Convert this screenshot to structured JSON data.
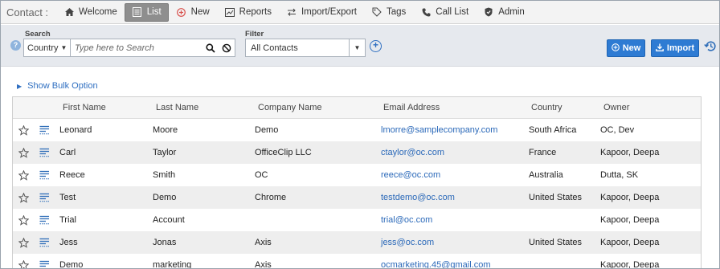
{
  "nav": {
    "module_title": "Contact :",
    "items": [
      {
        "label": "Welcome",
        "icon": "home-icon",
        "active": false
      },
      {
        "label": "List",
        "icon": "list-icon",
        "active": true
      },
      {
        "label": "New",
        "icon": "plus-circle-icon",
        "active": false
      },
      {
        "label": "Reports",
        "icon": "chart-icon",
        "active": false
      },
      {
        "label": "Import/Export",
        "icon": "transfer-icon",
        "active": false
      },
      {
        "label": "Tags",
        "icon": "tag-icon",
        "active": false
      },
      {
        "label": "Call List",
        "icon": "phone-icon",
        "active": false
      },
      {
        "label": "Admin",
        "icon": "shield-icon",
        "active": false
      }
    ]
  },
  "filterbar": {
    "search_label": "Search",
    "search_field": "Country",
    "search_placeholder": "Type here to Search",
    "filter_label": "Filter",
    "filter_value": "All Contacts",
    "new_button": "New",
    "import_button": "Import"
  },
  "bulk_option": "Show Bulk Option",
  "table": {
    "columns": [
      "First Name",
      "Last Name",
      "Company Name",
      "Email Address",
      "Country",
      "Owner"
    ],
    "rows": [
      [
        "Leonard",
        "Moore",
        "Demo",
        "lmorre@samplecompany.com",
        "South Africa",
        "OC, Dev"
      ],
      [
        "Carl",
        "Taylor",
        "OfficeClip LLC",
        "ctaylor@oc.com",
        "France",
        "Kapoor, Deepa"
      ],
      [
        "Reece",
        "Smith",
        "OC",
        "reece@oc.com",
        "Australia",
        "Dutta, SK"
      ],
      [
        "Test",
        "Demo",
        "Chrome",
        "testdemo@oc.com",
        "United States",
        "Kapoor, Deepa"
      ],
      [
        "Trial",
        "Account",
        "",
        "trial@oc.com",
        "",
        "Kapoor, Deepa"
      ],
      [
        "Jess",
        "Jonas",
        "Axis",
        "jess@oc.com",
        "United States",
        "Kapoor, Deepa"
      ],
      [
        "Demo",
        "marketing",
        "Axis",
        "ocmarketing.45@gmail.com",
        "",
        "Kapoor, Deepa"
      ]
    ]
  },
  "colors": {
    "accent": "#2e7bd3",
    "link": "#2b69b9",
    "active_tab": "#8e8e8e",
    "filter_bg": "#e6e9ee"
  }
}
